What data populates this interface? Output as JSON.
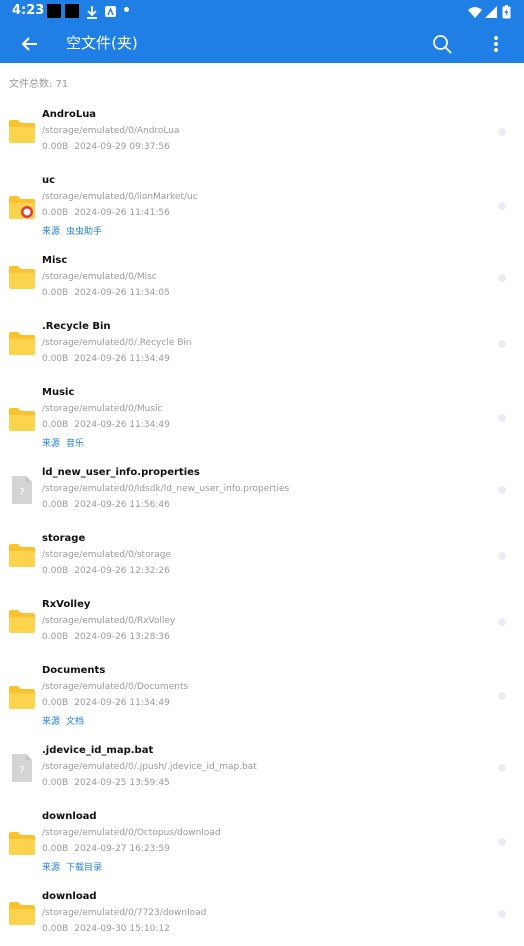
{
  "status_bar": {
    "time": "4:23"
  },
  "app_bar": {
    "title": "空文件(夹)"
  },
  "summary": {
    "label": "文件总数: 71"
  },
  "files": [
    {
      "name": "AndroLua",
      "path": "/storage/emulated/0/AndroLua",
      "size": "0.00B",
      "date": "2024-09-29 09:37:56",
      "type": "folder"
    },
    {
      "name": "uc",
      "path": "/storage/emulated/0/lionMarket/uc",
      "size": "0.00B",
      "date": "2024-09-26 11:41:56",
      "type": "folder-badge",
      "source_label": "来源",
      "source": "虫虫助手"
    },
    {
      "name": "Misc",
      "path": "/storage/emulated/0/Misc",
      "size": "0.00B",
      "date": "2024-09-26 11:34:05",
      "type": "folder"
    },
    {
      "name": ".Recycle Bin",
      "path": "/storage/emulated/0/.Recycle Bin",
      "size": "0.00B",
      "date": "2024-09-26 11:34:49",
      "type": "folder"
    },
    {
      "name": "Music",
      "path": "/storage/emulated/0/Music",
      "size": "0.00B",
      "date": "2024-09-26 11:34:49",
      "type": "folder",
      "source_label": "来源",
      "source": "音乐"
    },
    {
      "name": "ld_new_user_info.properties",
      "path": "/storage/emulated/0/ldsdk/ld_new_user_info.properties",
      "size": "0.00B",
      "date": "2024-09-26 11:56:46",
      "type": "file"
    },
    {
      "name": "storage",
      "path": "/storage/emulated/0/storage",
      "size": "0.00B",
      "date": "2024-09-26 12:32:26",
      "type": "folder"
    },
    {
      "name": "RxVolley",
      "path": "/storage/emulated/0/RxVolley",
      "size": "0.00B",
      "date": "2024-09-26 13:28:36",
      "type": "folder"
    },
    {
      "name": "Documents",
      "path": "/storage/emulated/0/Documents",
      "size": "0.00B",
      "date": "2024-09-26 11:34:49",
      "type": "folder",
      "source_label": "来源",
      "source": "文档"
    },
    {
      "name": ".jdevice_id_map.bat",
      "path": "/storage/emulated/0/.jpush/.jdevice_id_map.bat",
      "size": "0.00B",
      "date": "2024-09-25 13:59:45",
      "type": "file"
    },
    {
      "name": "download",
      "path": "/storage/emulated/0/Octopus/download",
      "size": "0.00B",
      "date": "2024-09-27 16:23:59",
      "type": "folder",
      "source_label": "来源",
      "source": "下载目录"
    },
    {
      "name": "download",
      "path": "/storage/emulated/0/7723/download",
      "size": "0.00B",
      "date": "2024-09-30 15:10:12",
      "type": "folder"
    }
  ],
  "colors": {
    "primary": "#1f7fe5",
    "folder": "#f9c22e",
    "file": "#d4d4d4"
  },
  "icons": {
    "back": "arrow-left-icon",
    "search": "search-icon",
    "more": "more-vert-icon"
  }
}
